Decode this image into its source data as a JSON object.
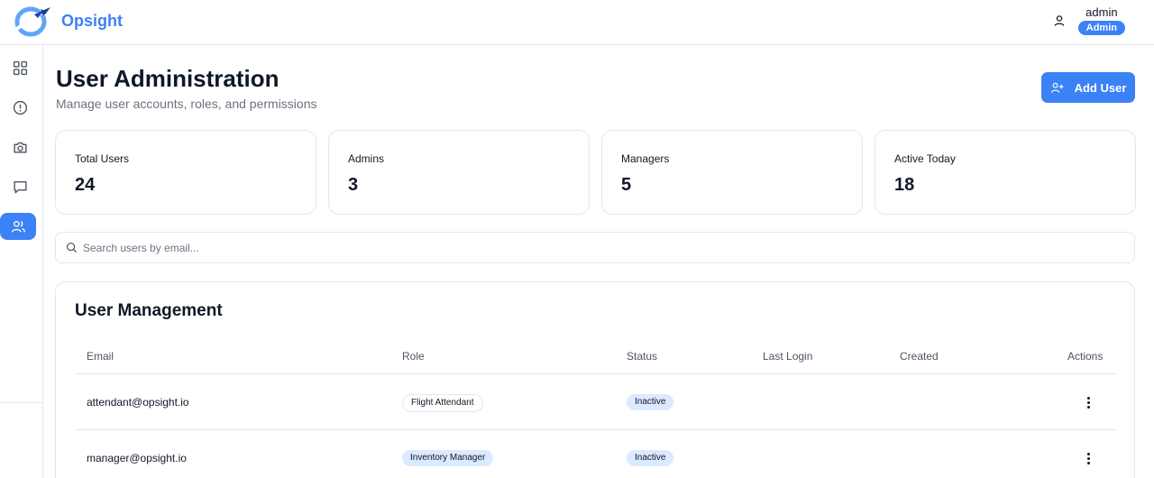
{
  "header": {
    "brand": "Opsight",
    "user_name": "admin",
    "user_role": "Admin"
  },
  "sidebar": {
    "items": [
      {
        "icon": "dashboard-icon",
        "active": false
      },
      {
        "icon": "alert-circle-icon",
        "active": false
      },
      {
        "icon": "camera-icon",
        "active": false
      },
      {
        "icon": "message-icon",
        "active": false
      },
      {
        "icon": "users-icon",
        "active": true
      }
    ]
  },
  "page": {
    "title": "User Administration",
    "subtitle": "Manage user accounts, roles, and permissions",
    "add_button": "Add User"
  },
  "stats": [
    {
      "label": "Total Users",
      "value": "24"
    },
    {
      "label": "Admins",
      "value": "3"
    },
    {
      "label": "Managers",
      "value": "5"
    },
    {
      "label": "Active Today",
      "value": "18"
    }
  ],
  "search": {
    "placeholder": "Search users by email..."
  },
  "table": {
    "title": "User Management",
    "columns": [
      "Email",
      "Role",
      "Status",
      "Last Login",
      "Created",
      "Actions"
    ],
    "rows": [
      {
        "email": "attendant@opsight.io",
        "role": "Flight Attendant",
        "status": "Inactive",
        "last_login": "",
        "created": ""
      },
      {
        "email": "manager@opsight.io",
        "role": "Inventory Manager",
        "status": "Inactive",
        "last_login": "",
        "created": ""
      }
    ]
  },
  "colors": {
    "accent": "#3b82f6",
    "pill_blue": "#dbeafe",
    "border": "#e5e7eb"
  }
}
